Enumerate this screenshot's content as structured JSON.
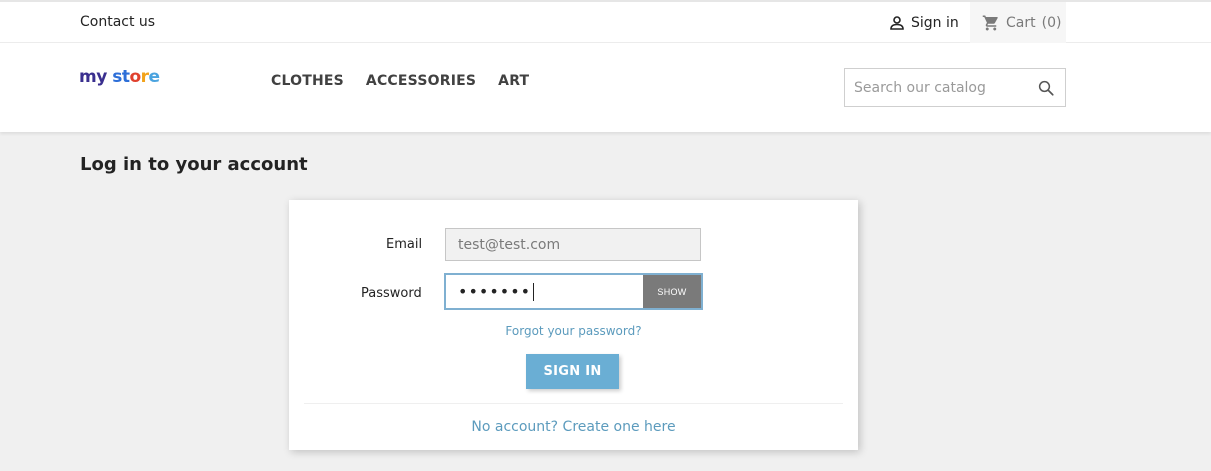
{
  "topbar": {
    "contact_label": "Contact us",
    "signin_label": "Sign in",
    "cart_label": "Cart",
    "cart_count": "(0)"
  },
  "header": {
    "logo": {
      "part1": "my",
      "part2": "st",
      "part3": "o",
      "part4": "r",
      "part5": "e"
    },
    "nav": [
      {
        "label": "CLOTHES"
      },
      {
        "label": "ACCESSORIES"
      },
      {
        "label": "ART"
      }
    ],
    "search_placeholder": "Search our catalog"
  },
  "page": {
    "title": "Log in to your account"
  },
  "form": {
    "email_label": "Email",
    "email_value": "test@test.com",
    "password_label": "Password",
    "password_masked": "•••••••",
    "show_label": "SHOW",
    "forgot_label": "Forgot your password?",
    "signin_button": "SIGN IN",
    "create_account": "No account? Create one here"
  },
  "colors": {
    "accent": "#6aaed4",
    "link": "#5c9bbd",
    "background": "#f0f0f0"
  },
  "icons": {
    "user": "user-icon",
    "cart": "cart-icon",
    "search": "search-icon"
  }
}
